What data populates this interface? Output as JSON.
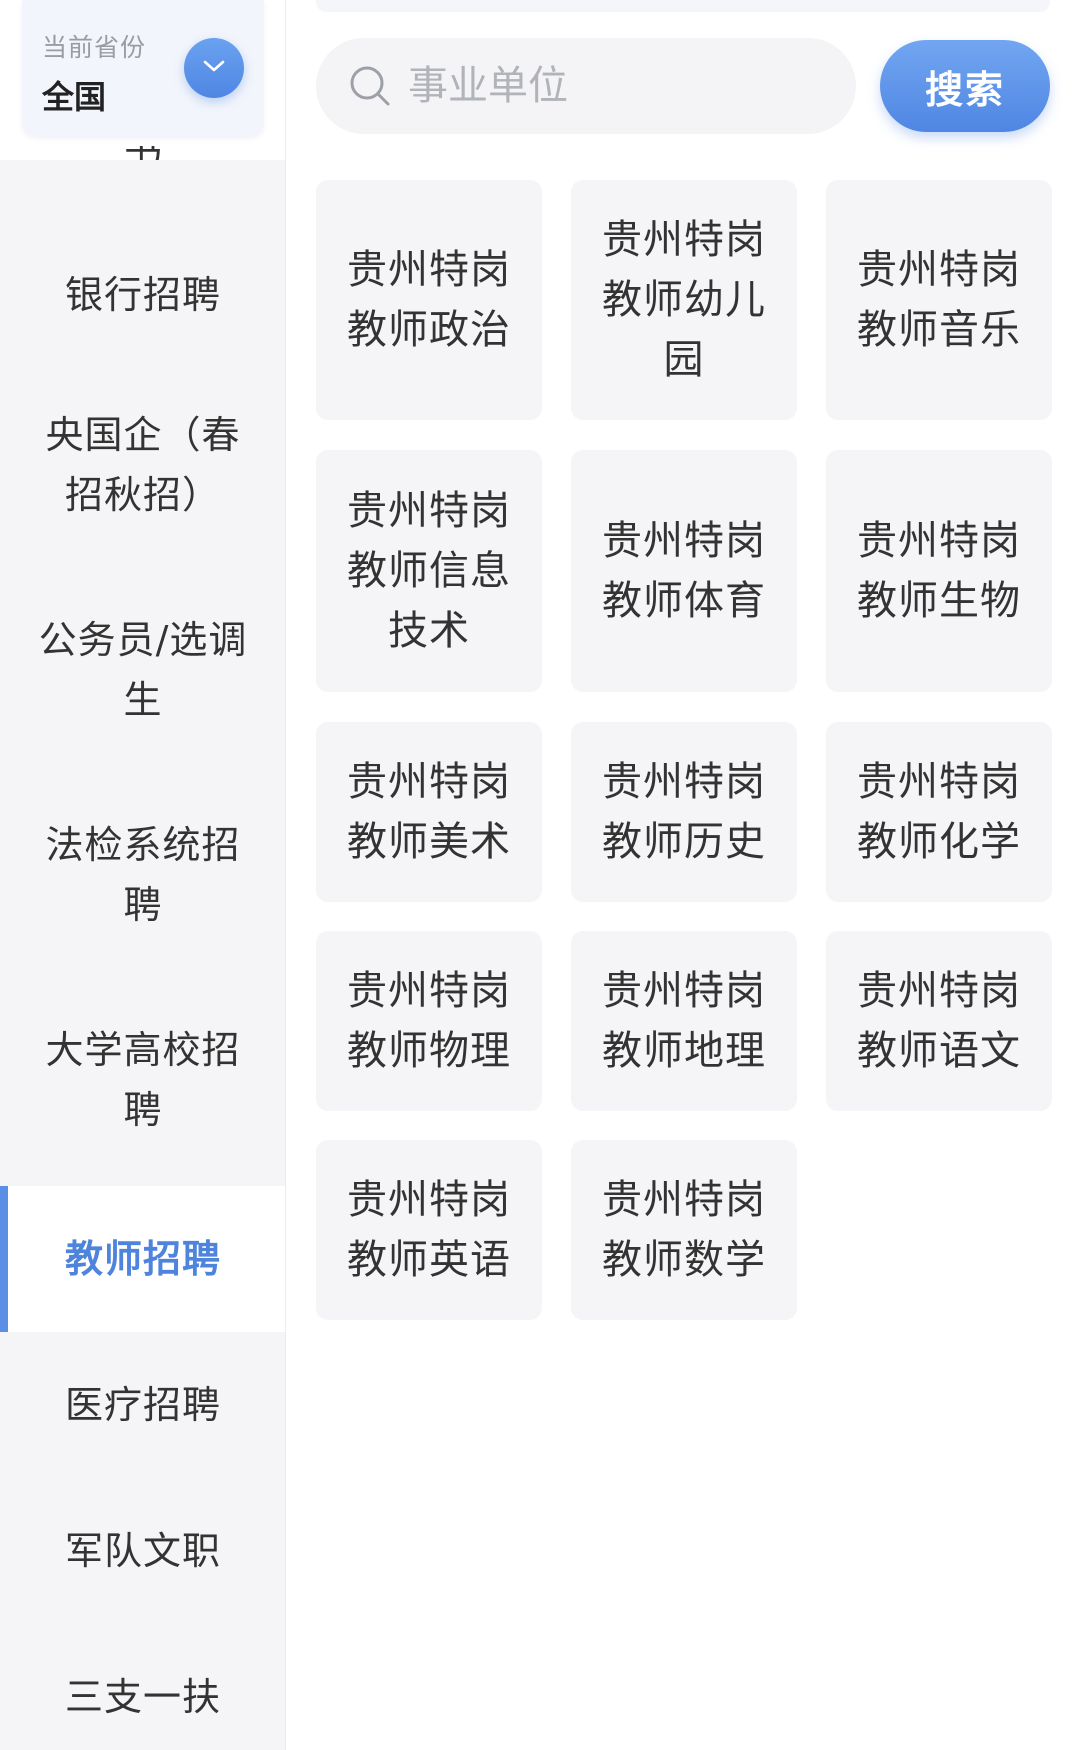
{
  "province": {
    "label": "当前省份",
    "value": "全国",
    "toggle_icon": "chevron-down-icon"
  },
  "sidebar": {
    "cut_item_fragment": "书",
    "items": [
      {
        "label": "银行招聘",
        "active": false
      },
      {
        "label": "央国企（春招秋招）",
        "active": false
      },
      {
        "label": "公务员/选调生",
        "active": false
      },
      {
        "label": "法检系统招聘",
        "active": false
      },
      {
        "label": "大学高校招聘",
        "active": false
      },
      {
        "label": "教师招聘",
        "active": true
      },
      {
        "label": "医疗招聘",
        "active": false
      },
      {
        "label": "军队文职",
        "active": false
      },
      {
        "label": "三支一扶",
        "active": false
      }
    ]
  },
  "search": {
    "placeholder": "事业单位",
    "value": "",
    "icon": "search-icon",
    "button_label": "搜索"
  },
  "categories": [
    "贵州特岗教师政治",
    "贵州特岗教师幼儿园",
    "贵州特岗教师音乐",
    "贵州特岗教师信息技术",
    "贵州特岗教师体育",
    "贵州特岗教师生物",
    "贵州特岗教师美术",
    "贵州特岗教师历史",
    "贵州特岗教师化学",
    "贵州特岗教师物理",
    "贵州特岗教师地理",
    "贵州特岗教师语文",
    "贵州特岗教师英语",
    "贵州特岗教师数学"
  ],
  "colors": {
    "accent": "#4f86e3",
    "active_text": "#4e84dc",
    "sidebar_bg": "#f5f5f7",
    "card_bg": "#f5f5f7"
  }
}
